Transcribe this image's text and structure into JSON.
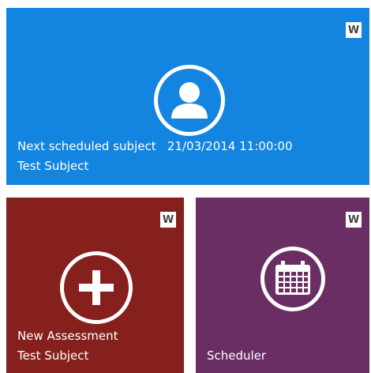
{
  "tiles": {
    "top": {
      "title": "Next scheduled subject",
      "datetime": "21/03/2014 11:00:00",
      "subject": "Test  Subject",
      "badge": "W",
      "icon": "person-icon",
      "color": "#1385e0"
    },
    "left": {
      "title": "New Assessment",
      "subject": "Test  Subject",
      "badge": "W",
      "icon": "plus-icon",
      "color": "#86201c"
    },
    "right": {
      "title": "Scheduler",
      "badge": "W",
      "icon": "calendar-icon",
      "color": "#6a2d64"
    }
  }
}
